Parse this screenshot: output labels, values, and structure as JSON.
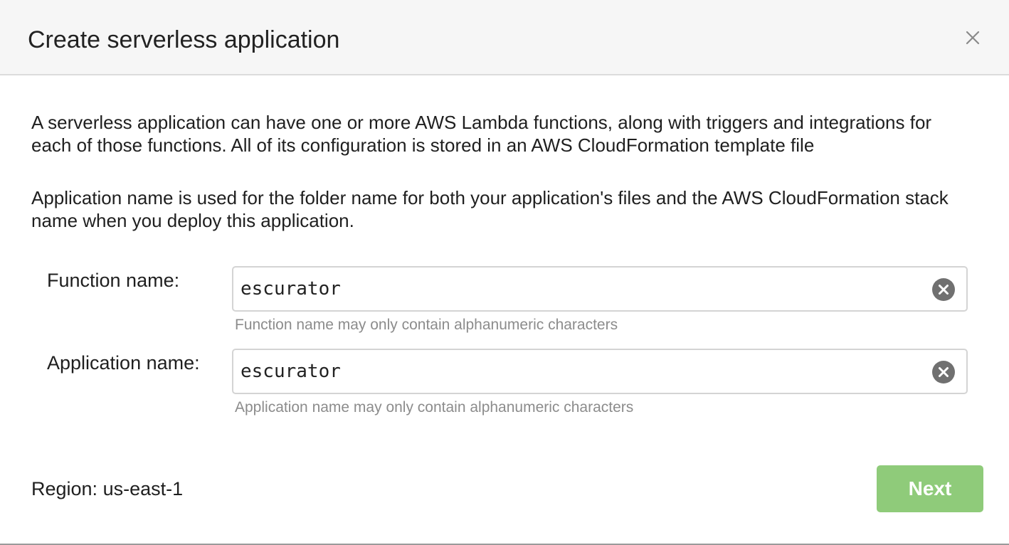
{
  "dialog": {
    "title": "Create serverless application",
    "close_icon": "close-icon"
  },
  "description": {
    "paragraph_1": "A serverless application can have one or more AWS Lambda functions, along with triggers and integrations for each of those functions. All of its configuration is stored in an AWS CloudFormation template file",
    "paragraph_2": "Application name is used for the folder name for both your application's files and the AWS CloudFormation stack name when you deploy this application."
  },
  "form": {
    "function_name": {
      "label": "Function name:",
      "value": "escurator",
      "helper": "Function name may only contain alphanumeric characters",
      "clear_icon": "clear-circle-icon"
    },
    "application_name": {
      "label": "Application name:",
      "value": "escurator",
      "helper": "Application name may only contain alphanumeric characters",
      "clear_icon": "clear-circle-icon"
    }
  },
  "footer": {
    "region": "Region: us-east-1",
    "next_label": "Next"
  },
  "colors": {
    "header_bg": "#f6f6f6",
    "next_button_bg": "#8fcb7a",
    "helper_text": "#8c8c8c",
    "clear_icon": "#707070"
  }
}
